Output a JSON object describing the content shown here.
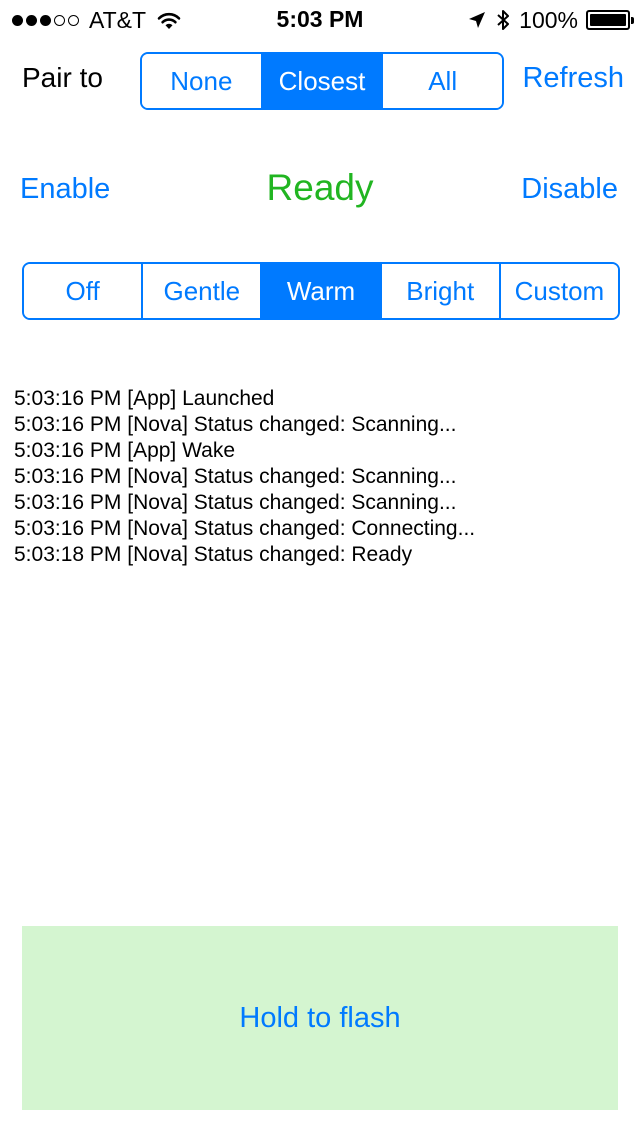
{
  "status_bar": {
    "carrier": "AT&T",
    "signal_full": 3,
    "signal_empty": 2,
    "time": "5:03 PM",
    "battery_percent": "100%",
    "icons": [
      "wifi-icon",
      "location-arrow-icon",
      "bluetooth-icon",
      "battery-icon"
    ]
  },
  "pair": {
    "label": "Pair to",
    "options": [
      "None",
      "Closest",
      "All"
    ],
    "selected": "Closest",
    "refresh_label": "Refresh"
  },
  "controls": {
    "enable_label": "Enable",
    "status": "Ready",
    "disable_label": "Disable",
    "status_color": "#21b521"
  },
  "mode": {
    "options": [
      "Off",
      "Gentle",
      "Warm",
      "Bright",
      "Custom"
    ],
    "selected": "Warm"
  },
  "log": [
    "5:03:16 PM [App] Launched",
    "5:03:16 PM [Nova] Status changed: Scanning...",
    "5:03:16 PM [App] Wake",
    "5:03:16 PM [Nova] Status changed: Scanning...",
    "5:03:16 PM [Nova] Status changed: Scanning...",
    "5:03:16 PM [Nova] Status changed: Connecting...",
    "5:03:18 PM [Nova] Status changed: Ready"
  ],
  "flash_button": {
    "label": "Hold to flash",
    "background": "#d4f5d0"
  },
  "colors": {
    "accent": "#007aff",
    "ready_green": "#21b521"
  }
}
